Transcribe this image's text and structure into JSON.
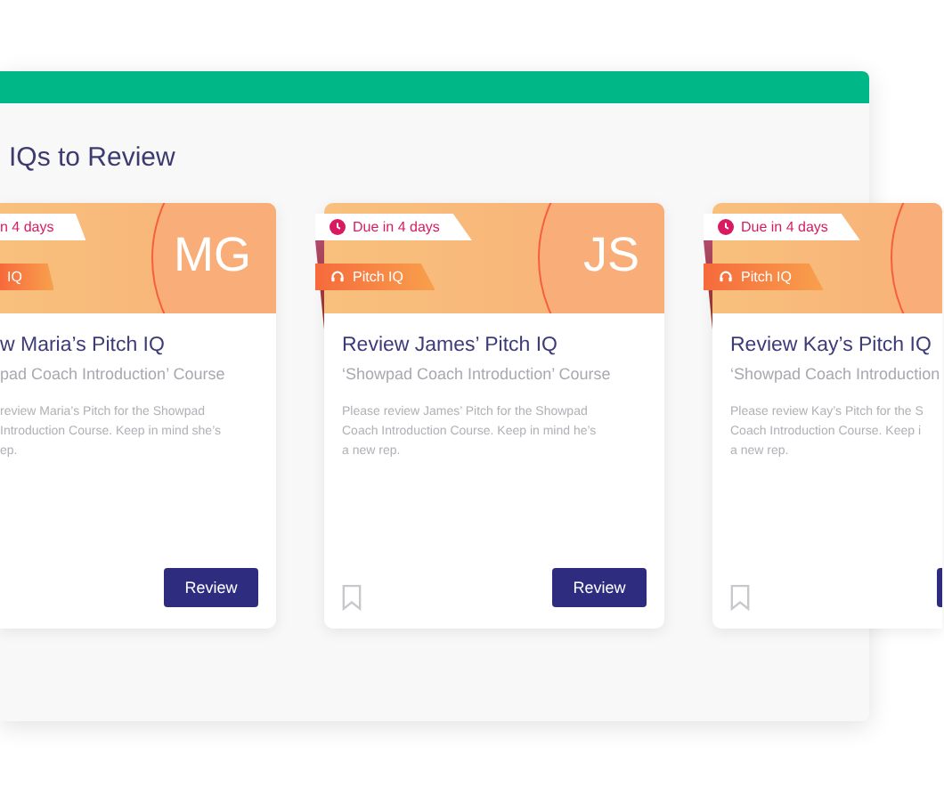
{
  "section": {
    "title": "IQs to Review"
  },
  "cards": [
    {
      "kind": "left-cut",
      "due": "n 4 days",
      "type_label": "IQ",
      "initials": "MG",
      "title": "w Maria’s Pitch IQ",
      "course": "pad Coach Introduction’ Course",
      "description": [
        "review Maria’s Pitch for the Showpad",
        "Introduction Course. Keep in mind she’s",
        "ep."
      ],
      "button": "Review"
    },
    {
      "kind": "full",
      "due": "Due in 4 days",
      "type_label": "Pitch IQ",
      "initials": "JS",
      "title": "Review James’ Pitch IQ",
      "course": "‘Showpad Coach Introduction’ Course",
      "description": [
        "Please review James’ Pitch for the Showpad",
        "Coach Introduction Course. Keep in mind he’s",
        "a new rep."
      ],
      "button": "Review"
    },
    {
      "kind": "right-cut",
      "due": "Due in 4 days",
      "type_label": "Pitch IQ",
      "title": "Review Kay’s Pitch IQ",
      "course": "‘Showpad Coach Introduction",
      "description": [
        "Please review Kay’s Pitch for the S",
        "Coach Introduction Course. Keep i",
        "a new rep."
      ]
    }
  ]
}
